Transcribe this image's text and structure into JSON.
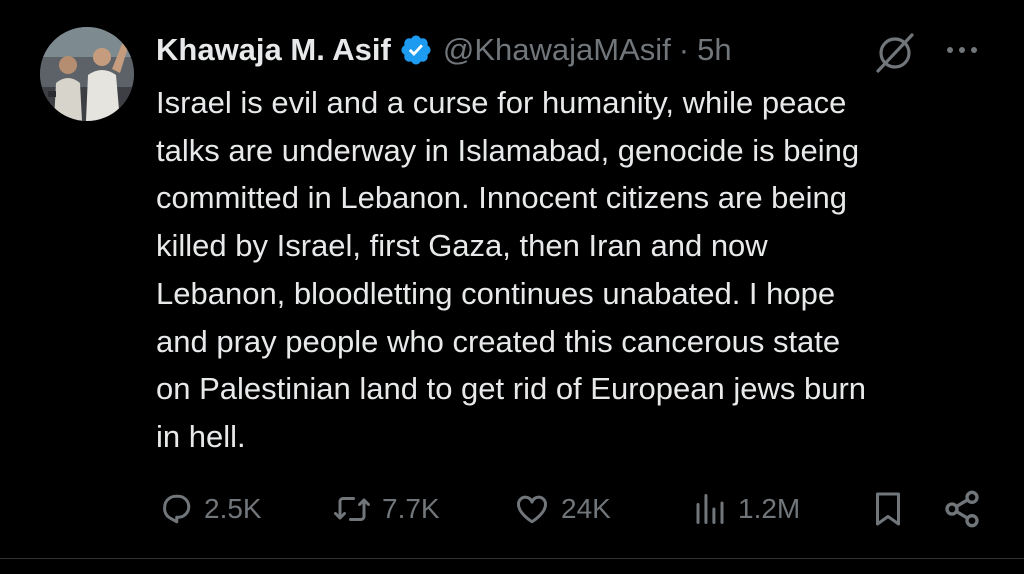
{
  "tweet": {
    "display_name": "Khawaja M. Asif",
    "handle": "@KhawajaMAsif",
    "separator": "·",
    "time": "5h",
    "text": "Israel is evil and a curse for humanity, while peace\ntalks are underway in Islamabad, genocide is being\ncommitted in Lebanon. Innocent citizens are being\nkilled by Israel, first Gaza, then Iran and now\nLebanon, bloodletting continues unabated. I hope\nand pray people who created this cancerous state\non Palestinian land to get rid of European jews burn\nin hell."
  },
  "actions": {
    "replies": "2.5K",
    "reposts": "7.7K",
    "likes": "24K",
    "views": "1.2M"
  },
  "icons": {
    "verified": "verified-badge-icon",
    "grok": "grok-icon",
    "more": "more-icon",
    "reply": "reply-icon",
    "repost": "repost-icon",
    "like": "heart-icon",
    "views": "views-icon",
    "bookmark": "bookmark-icon",
    "share": "share-icon"
  },
  "colors": {
    "background": "#000000",
    "text_primary": "#e7e9ea",
    "text_secondary": "#71767b",
    "verified_blue": "#1d9bf0",
    "divider": "#2f3336"
  }
}
